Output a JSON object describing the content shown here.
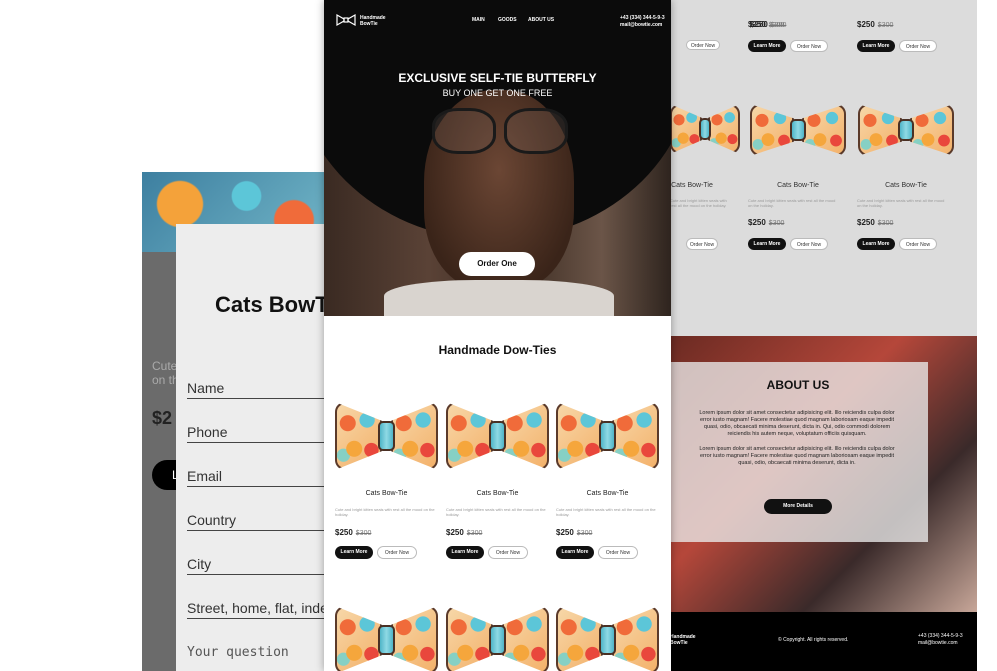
{
  "brand": {
    "line1": "Handmade",
    "line2": "BowTie"
  },
  "nav": {
    "items": [
      "MAIN",
      "GOODS",
      "ABOUT US"
    ]
  },
  "contact": {
    "phone": "+43 (334) 344-5-9-3",
    "email": "mail@bowtie.com"
  },
  "hero": {
    "title": "EXCLUSIVE SELF-TIE BUTTERFLY",
    "subtitle": "BUY ONE GET ONE FREE",
    "cta": "Order One"
  },
  "catalog": {
    "title": "Handmade Dow-Ties",
    "product_name": "Cats Bow-Tie",
    "description": "Cute and bright kitten seals with rest all the mood on the holiday.",
    "price": "$250",
    "old_price": "$300",
    "learn_more": "Learn More",
    "order_now": "Order Now"
  },
  "about": {
    "title": "ABOUT US",
    "p1": "Lorem ipsum dolor sit amet consectetur adipisicing elit. Illo reiciendis culpa dolor error iusto magnam! Facere molestiae quod magnam laboriosam eaque impedit quasi, odio, obcaecati minima deserunt, dicta in. Qui, odio commodi dolorem reiciendis his autem neque, voluptatum officiis quisquam.",
    "p2": "Lorem ipsum dolor sit amet consectetur adipisicing elit. Illo reiciendis culpa dolor error iusto magnam! Facere molestiae quod magnam laboriosam eaque impedit quasi, odio, obcaecati minima deserunt, dicta in.",
    "button": "More Details"
  },
  "footer": {
    "copyright": "© Copyright. All rights reserved."
  },
  "form": {
    "title": "Cats BowT",
    "desc_fragment_1": "Cute",
    "desc_fragment_2": "on th",
    "price_fragment": "$2",
    "btn_fragment": "L",
    "fields": [
      "Name",
      "Phone",
      "Email",
      "Country",
      "City",
      "Street, home, flat, index"
    ],
    "question_placeholder": "Your question"
  },
  "colors": {
    "accent": "#000000",
    "panel": "#ededed",
    "backdrop": "#dcdcdc"
  },
  "icons": {
    "logo": "bow-tie-logo-icon"
  }
}
